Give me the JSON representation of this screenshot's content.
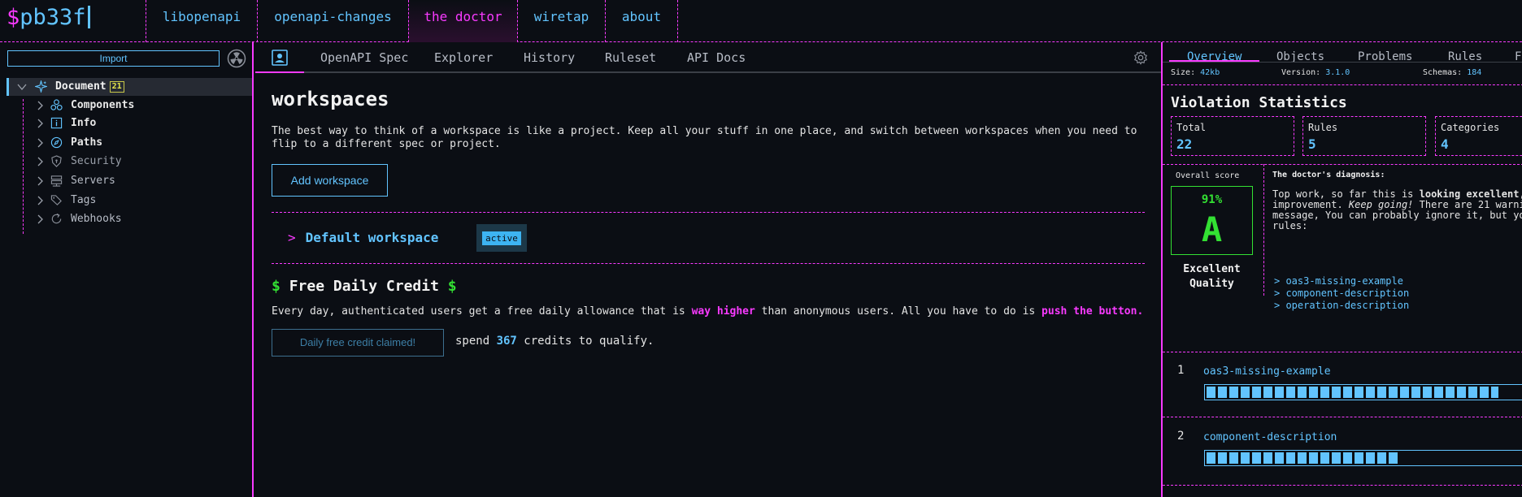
{
  "logo": {
    "dollar": "$",
    "name": "pb33f"
  },
  "nav": [
    {
      "label": "libopenapi"
    },
    {
      "label": "openapi-changes"
    },
    {
      "label": "the doctor"
    },
    {
      "label": "wiretap"
    },
    {
      "label": "about"
    }
  ],
  "sidebar": {
    "import_label": "Import",
    "document": {
      "label": "Document",
      "count": "21"
    },
    "items": [
      {
        "label": "Components",
        "icon": "components-icon"
      },
      {
        "label": "Info",
        "icon": "info-icon"
      },
      {
        "label": "Paths",
        "icon": "compass-icon"
      },
      {
        "label": "Security",
        "icon": "shield-icon"
      },
      {
        "label": "Servers",
        "icon": "server-icon"
      },
      {
        "label": "Tags",
        "icon": "tags-icon"
      },
      {
        "label": "Webhooks",
        "icon": "refresh-icon"
      }
    ]
  },
  "center": {
    "tabs": [
      "OpenAPI Spec",
      "Explorer",
      "History",
      "Ruleset",
      "API Docs"
    ],
    "title": "workspaces",
    "description": "The best way to think of a workspace is like a project. Keep all your stuff in one place, and switch between workspaces when you need to flip to a different spec or project.",
    "add_button": "Add workspace",
    "workspace": {
      "marker": ">",
      "name": "Default workspace",
      "badge": "active"
    },
    "credit": {
      "dollar": "$",
      "title": "Free Daily Credit",
      "desc_pre": "Every day, authenticated users get a free daily allowance that is ",
      "desc_hl1": "way higher",
      "desc_mid": " than anonymous users. All you have to do is ",
      "desc_hl2": "push the button.",
      "claim_button": "Daily free credit claimed!",
      "spend_pre": "spend ",
      "spend_num": "367",
      "spend_post": " credits to qualify."
    }
  },
  "right": {
    "tabs": [
      "Overview",
      "Objects",
      "Problems",
      "Rules",
      "F"
    ],
    "stats": {
      "size_label": "Size:",
      "size_value": "42kb",
      "version_label": "Version:",
      "version_value": "3.1.0",
      "schemas_label": "Schemas:",
      "schemas_value": "184"
    },
    "violation_title": "Violation Statistics",
    "boxes": [
      {
        "label": "Total",
        "value": "22"
      },
      {
        "label": "Rules",
        "value": "5"
      },
      {
        "label": "Categories",
        "value": "4"
      }
    ],
    "score_label": "Overall score",
    "score_pct": "91%",
    "score_grade": "A",
    "quality": "Excellent Quality",
    "diagnosis_title": "The doctor's diagnosis:",
    "diag": {
      "l1_pre": "Top work, so far this is ",
      "l1_b": "looking excellent",
      "l1_post": ",",
      "l2_pre": "improvement. ",
      "l2_i": "Keep going!",
      "l2_post": " There are 21 warni",
      "l3": "message, You can probably ignore it, but yo",
      "l4": "rules:"
    },
    "diag_rules": [
      "> oas3-missing-example",
      "> component-description",
      "> operation-description"
    ],
    "violations": [
      {
        "rank": "1",
        "name": "oas3-missing-example",
        "fill": 0.86
      },
      {
        "rank": "2",
        "name": "component-description",
        "fill": 0.57
      }
    ]
  }
}
